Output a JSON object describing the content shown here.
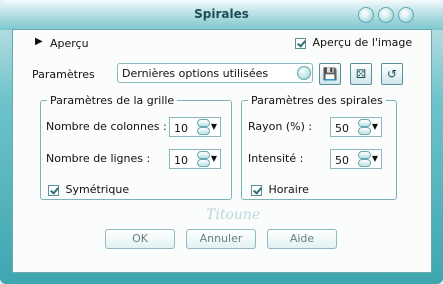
{
  "window": {
    "title": "Spirales"
  },
  "preview": {
    "toggle_label": "Aperçu",
    "show_image_label": "Aperçu de l'image"
  },
  "presets": {
    "label": "Paramètres",
    "value": "Dernières options utilisées"
  },
  "grid": {
    "legend": "Paramètres de la grille",
    "columns_label": "Nombre de colonnes :",
    "columns_value": "10",
    "rows_label": "Nombre de lignes :",
    "rows_value": "10",
    "symmetric_label": "Symétrique"
  },
  "spirals": {
    "legend": "Paramètres des spirales",
    "radius_label": "Rayon (%) :",
    "radius_value": "50",
    "intensity_label": "Intensité :",
    "intensity_value": "50",
    "clockwise_label": "Horaire"
  },
  "watermark": "Titoune",
  "buttons": {
    "ok": "OK",
    "cancel": "Annuler",
    "help": "Aide"
  },
  "icons": {
    "toolbar": [
      "save-icon",
      "randomize-icon",
      "reset-icon"
    ],
    "window_controls": [
      "help-window-icon",
      "minimize-window-icon",
      "close-window-icon"
    ]
  }
}
